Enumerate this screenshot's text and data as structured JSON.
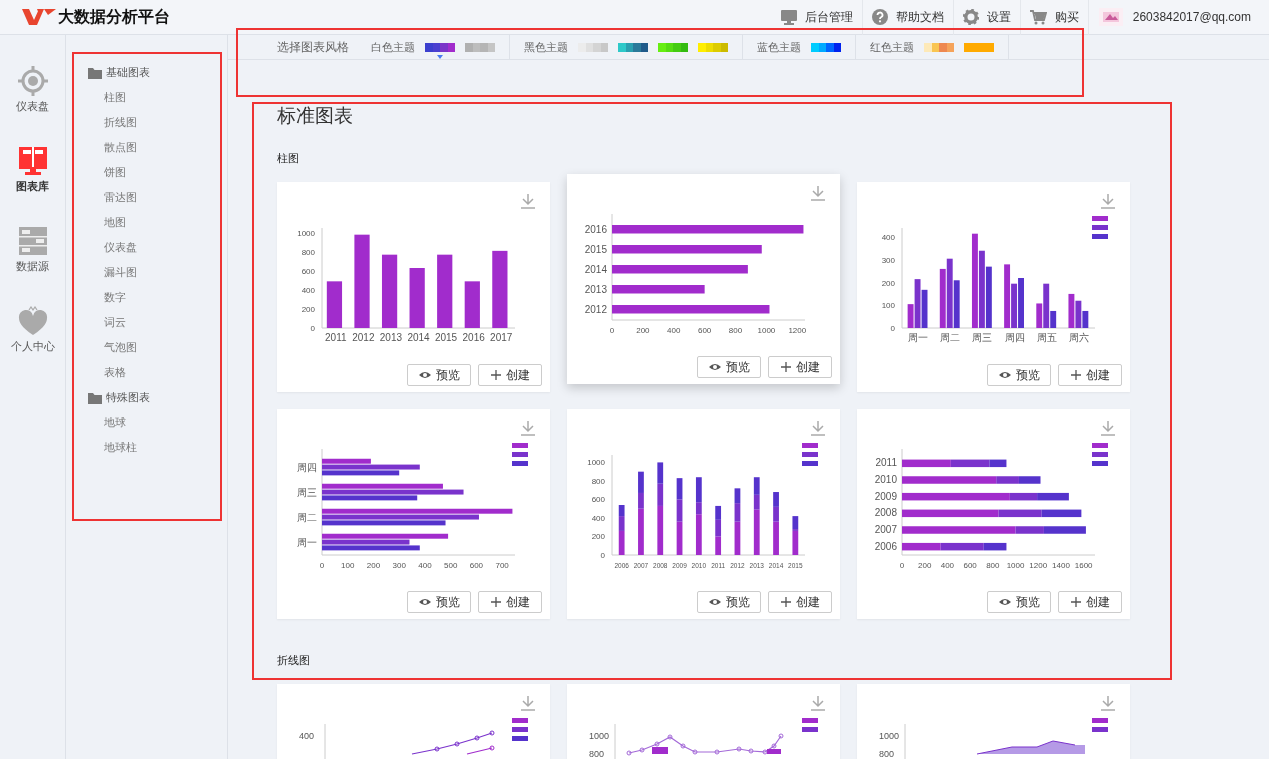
{
  "header": {
    "logo_text": "大数据分析平台",
    "menu": [
      {
        "label": "后台管理"
      },
      {
        "label": "帮助文档"
      },
      {
        "label": "设置"
      },
      {
        "label": "购买"
      }
    ],
    "user": {
      "email": "2603842017@qq.com"
    }
  },
  "nav_rail": [
    {
      "label": "仪表盘",
      "selected": false
    },
    {
      "label": "图表库",
      "selected": true
    },
    {
      "label": "数据源",
      "selected": false
    },
    {
      "label": "个人中心",
      "selected": false
    }
  ],
  "chart_tree": [
    {
      "label": "基础图表",
      "children": [
        {
          "label": "柱图"
        },
        {
          "label": "折线图"
        },
        {
          "label": "散点图"
        },
        {
          "label": "饼图"
        },
        {
          "label": "雷达图"
        },
        {
          "label": "地图"
        },
        {
          "label": "仪表盘"
        },
        {
          "label": "漏斗图"
        },
        {
          "label": "数字"
        },
        {
          "label": "词云"
        },
        {
          "label": "气泡图"
        },
        {
          "label": "表格"
        }
      ]
    },
    {
      "label": "特殊图表",
      "children": [
        {
          "label": "地球"
        },
        {
          "label": "地球柱"
        }
      ]
    }
  ],
  "theme_bar": {
    "label": "选择图表风格",
    "themes": [
      {
        "label": "白色主题",
        "palettes": [
          {
            "swatches": [
              {
                "color": "#3b3fce"
              },
              {
                "color": "#4a3fd0"
              },
              {
                "color": "#7a35c8"
              },
              {
                "color": "#a22ccc"
              }
            ],
            "selected": true
          },
          {
            "swatches": [
              {
                "color": "#b0b0b0"
              },
              {
                "color": "#bdbdbd"
              },
              {
                "color": "#b5b5b5"
              },
              {
                "color": "#c5c5c5"
              }
            ],
            "selected": false
          }
        ]
      },
      {
        "label": "黑色主题",
        "palettes": [
          {
            "swatches": [
              {
                "color": "#ececec"
              },
              {
                "color": "#e0e0e0"
              },
              {
                "color": "#d4d4d4"
              },
              {
                "color": "#c8c8c8"
              }
            ],
            "selected": false
          },
          {
            "swatches": [
              {
                "color": "#2ec9c9"
              },
              {
                "color": "#2aa0b0"
              },
              {
                "color": "#2a7a9a"
              },
              {
                "color": "#1f5a8a"
              }
            ],
            "selected": false
          },
          {
            "swatches": [
              {
                "color": "#66ee11"
              },
              {
                "color": "#55dd11"
              },
              {
                "color": "#44cc11"
              },
              {
                "color": "#33bb11"
              }
            ],
            "selected": false
          },
          {
            "swatches": [
              {
                "color": "#ffee00"
              },
              {
                "color": "#eedd00"
              },
              {
                "color": "#ddcc00"
              },
              {
                "color": "#ccbb00"
              }
            ],
            "selected": false
          }
        ]
      },
      {
        "label": "蓝色主题",
        "palettes": [
          {
            "swatches": [
              {
                "color": "#00ccff"
              },
              {
                "color": "#00aaff"
              },
              {
                "color": "#0066ff"
              },
              {
                "color": "#0022ee"
              }
            ],
            "selected": false
          }
        ]
      },
      {
        "label": "红色主题",
        "palettes": [
          {
            "swatches": [
              {
                "color": "#fde9b8"
              },
              {
                "color": "#f9c552"
              },
              {
                "color": "#ee8850"
              },
              {
                "color": "#f5a35a"
              }
            ],
            "selected": false
          },
          {
            "swatches": [
              {
                "color": "#ffaa00"
              },
              {
                "color": "#ffaa00"
              },
              {
                "color": "#ffaa00"
              },
              {
                "color": "#ffaa00"
              }
            ],
            "selected": false
          }
        ]
      }
    ]
  },
  "gallery": {
    "title": "标准图表",
    "sections": [
      {
        "title": "柱图",
        "cards": [
          {
            "kind": "chart",
            "raised": false,
            "buttons": [
              {
                "label": "预览",
                "kind": "preview"
              },
              {
                "label": "创建",
                "kind": "create"
              }
            ],
            "chart_data": {
              "type": "bar",
              "orientation": "vertical",
              "categories": [
                "2011",
                "2012",
                "2013",
                "2014",
                "2015",
                "2016",
                "2017"
              ],
              "series": [
                {
                  "color": "#a12ccc",
                  "values": [
                    490,
                    980,
                    770,
                    630,
                    770,
                    490,
                    810
                  ]
                }
              ],
              "ylim": [
                0,
                1050
              ],
              "yticks": [
                0,
                200,
                400,
                600,
                800,
                1000
              ]
            }
          },
          {
            "kind": "chart",
            "raised": true,
            "buttons": [
              {
                "label": "预览",
                "kind": "preview"
              },
              {
                "label": "创建",
                "kind": "create"
              }
            ],
            "chart_data": {
              "type": "bar",
              "orientation": "horizontal",
              "categories": [
                "2016",
                "2015",
                "2014",
                "2013",
                "2012"
              ],
              "series": [
                {
                  "color": "#a12ccc",
                  "values": [
                    1240,
                    970,
                    880,
                    600,
                    1020
                  ]
                }
              ],
              "xlim": [
                0,
                1250
              ],
              "xticks": [
                0,
                200,
                400,
                600,
                800,
                1000,
                1200
              ]
            }
          },
          {
            "kind": "chart",
            "raised": false,
            "buttons": [
              {
                "label": "预览",
                "kind": "preview"
              },
              {
                "label": "创建",
                "kind": "create"
              }
            ],
            "chart_data": {
              "type": "bar",
              "orientation": "vertical",
              "categories": [
                "周一",
                "周二",
                "周三",
                "周四",
                "周五",
                "周六"
              ],
              "series": [
                {
                  "color": "#a12ccc",
                  "values": [
                    105,
                    260,
                    415,
                    280,
                    108,
                    150
                  ]
                },
                {
                  "color": "#7a33cc",
                  "values": [
                    215,
                    305,
                    340,
                    195,
                    195,
                    120
                  ]
                },
                {
                  "color": "#5533cc",
                  "values": [
                    168,
                    210,
                    270,
                    220,
                    75,
                    75
                  ]
                }
              ],
              "ylim": [
                0,
                440
              ],
              "yticks": [
                0,
                100,
                200,
                300,
                400
              ]
            }
          },
          {
            "kind": "chart",
            "raised": false,
            "buttons": [
              {
                "label": "预览",
                "kind": "preview"
              },
              {
                "label": "创建",
                "kind": "create"
              }
            ],
            "chart_data": {
              "type": "bar",
              "orientation": "horizontal",
              "categories": [
                "周四",
                "周三",
                "周二",
                "周一"
              ],
              "series": [
                {
                  "color": "#a12ccc",
                  "values": [
                    190,
                    470,
                    740,
                    490
                  ]
                },
                {
                  "color": "#7a33cc",
                  "values": [
                    380,
                    550,
                    610,
                    340
                  ]
                },
                {
                  "color": "#5533cc",
                  "values": [
                    300,
                    370,
                    480,
                    380
                  ]
                }
              ],
              "xlim": [
                0,
                750
              ],
              "xticks": [
                0,
                100,
                200,
                300,
                400,
                500,
                600,
                700
              ]
            }
          },
          {
            "kind": "chart",
            "raised": false,
            "buttons": [
              {
                "label": "预览",
                "kind": "preview"
              },
              {
                "label": "创建",
                "kind": "create"
              }
            ],
            "chart_data": {
              "type": "bar",
              "orientation": "vertical",
              "stacked": true,
              "categories": [
                "2006",
                "2007",
                "2008",
                "2009",
                "2010",
                "2011",
                "2012",
                "2013",
                "2014",
                "2015"
              ],
              "series": [
                {
                  "color": "#a12ccc",
                  "values": [
                    260,
                    500,
                    530,
                    360,
                    440,
                    200,
                    360,
                    490,
                    360,
                    260
                  ]
                },
                {
                  "color": "#7a33cc",
                  "values": [
                    160,
                    170,
                    240,
                    240,
                    130,
                    180,
                    200,
                    160,
                    160,
                    20
                  ]
                },
                {
                  "color": "#5533cc",
                  "values": [
                    120,
                    230,
                    230,
                    230,
                    270,
                    150,
                    160,
                    190,
                    160,
                    140
                  ]
                }
              ],
              "ylim": [
                0,
                1080
              ],
              "yticks": [
                0,
                200,
                400,
                600,
                800,
                1000
              ]
            }
          },
          {
            "kind": "chart",
            "raised": false,
            "buttons": [
              {
                "label": "预览",
                "kind": "preview"
              },
              {
                "label": "创建",
                "kind": "create"
              }
            ],
            "chart_data": {
              "type": "bar",
              "orientation": "horizontal",
              "stacked": true,
              "categories": [
                "2011",
                "2010",
                "2009",
                "2008",
                "2007",
                "2006"
              ],
              "series": [
                {
                  "color": "#a12ccc",
                  "values": [
                    430,
                    830,
                    950,
                    850,
                    1000,
                    340
                  ]
                },
                {
                  "color": "#7a33cc",
                  "values": [
                    340,
                    200,
                    240,
                    380,
                    250,
                    380
                  ]
                },
                {
                  "color": "#5533cc",
                  "values": [
                    150,
                    190,
                    280,
                    350,
                    370,
                    200
                  ]
                }
              ],
              "xlim": [
                0,
                1700
              ],
              "xticks": [
                0,
                200,
                400,
                600,
                800,
                1000,
                1200,
                1400,
                1600
              ]
            }
          }
        ]
      },
      {
        "title": "折线图",
        "cards": [
          {
            "kind": "line-preview",
            "raised": false,
            "scale_labels": [
              {
                "text": "400"
              }
            ],
            "legend": [
              {
                "color": "#a12ccc"
              },
              {
                "color": "#7a33cc"
              },
              {
                "color": "#5533cc"
              }
            ]
          },
          {
            "kind": "line-preview",
            "raised": false,
            "scale_labels": [
              {
                "text": "1000"
              },
              {
                "text": "800"
              }
            ],
            "legend": [
              {
                "color": "#a12ccc"
              },
              {
                "color": "#7a33cc"
              }
            ]
          },
          {
            "kind": "area-preview",
            "raised": false,
            "scale_labels": [
              {
                "text": "1000"
              },
              {
                "text": "800"
              }
            ],
            "legend": [
              {
                "color": "#a12ccc"
              },
              {
                "color": "#7a33cc"
              }
            ]
          }
        ]
      }
    ]
  }
}
